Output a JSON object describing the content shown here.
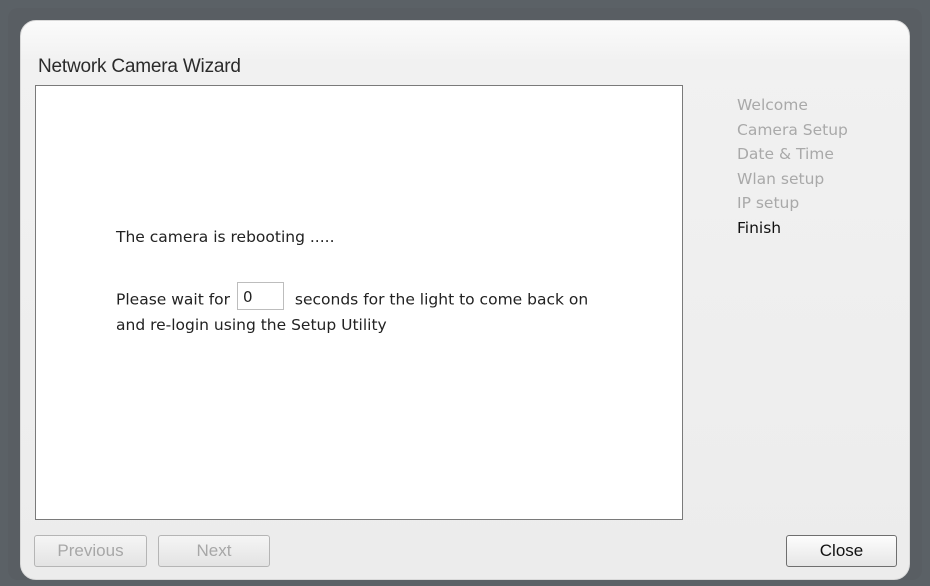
{
  "wizard": {
    "title": "Network Camera Wizard",
    "message_rebooting": "The camera is rebooting .....",
    "wait_prefix": "Please wait for",
    "countdown_value": "0",
    "wait_suffix": "seconds for the light to come back on and re-login using the Setup Utility"
  },
  "steps": [
    "Welcome",
    "Camera Setup",
    "Date & Time",
    "Wlan setup",
    "IP setup",
    "Finish"
  ],
  "current_step": "Finish",
  "buttons": {
    "previous": "Previous",
    "next": "Next",
    "close": "Close"
  },
  "colors": {
    "outer_background": "#5b6166",
    "dialog_background": "#ececec",
    "inactive_step": "#a9a9a9",
    "active_step": "#111111"
  }
}
